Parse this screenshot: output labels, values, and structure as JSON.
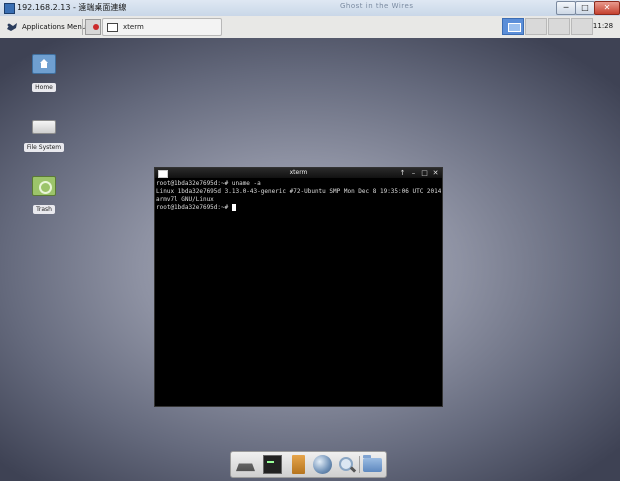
{
  "outer_window": {
    "title": "192.168.2.13 - 遠端桌面連線",
    "ghost_title": "Ghost in the Wires",
    "min_symbol": "─",
    "max_symbol": "□",
    "close_symbol": "✕"
  },
  "panel": {
    "applications_label": "Applications Menu",
    "task_label": "xterm",
    "clock": "11:28"
  },
  "desktop_icons": {
    "home": "Home",
    "filesystem": "File System",
    "trash": "Trash"
  },
  "xterm": {
    "title": "xterm",
    "controls": {
      "up": "↑",
      "minimize": "–",
      "maximize": "□",
      "close": "✕"
    },
    "lines": [
      "root@1bda32e7695d:~# uname -a",
      "Linux 1bda32e7695d 3.13.0-43-generic #72-Ubuntu SMP Mon Dec 8 19:35:06 UTC 2014",
      "armv7l GNU/Linux",
      "root@1bda32e7695d:~# "
    ]
  },
  "dock": {
    "items": [
      "show-desktop-icon",
      "terminal-icon",
      "file-manager-icon",
      "web-browser-icon",
      "app-finder-icon",
      "folder-icon"
    ]
  }
}
